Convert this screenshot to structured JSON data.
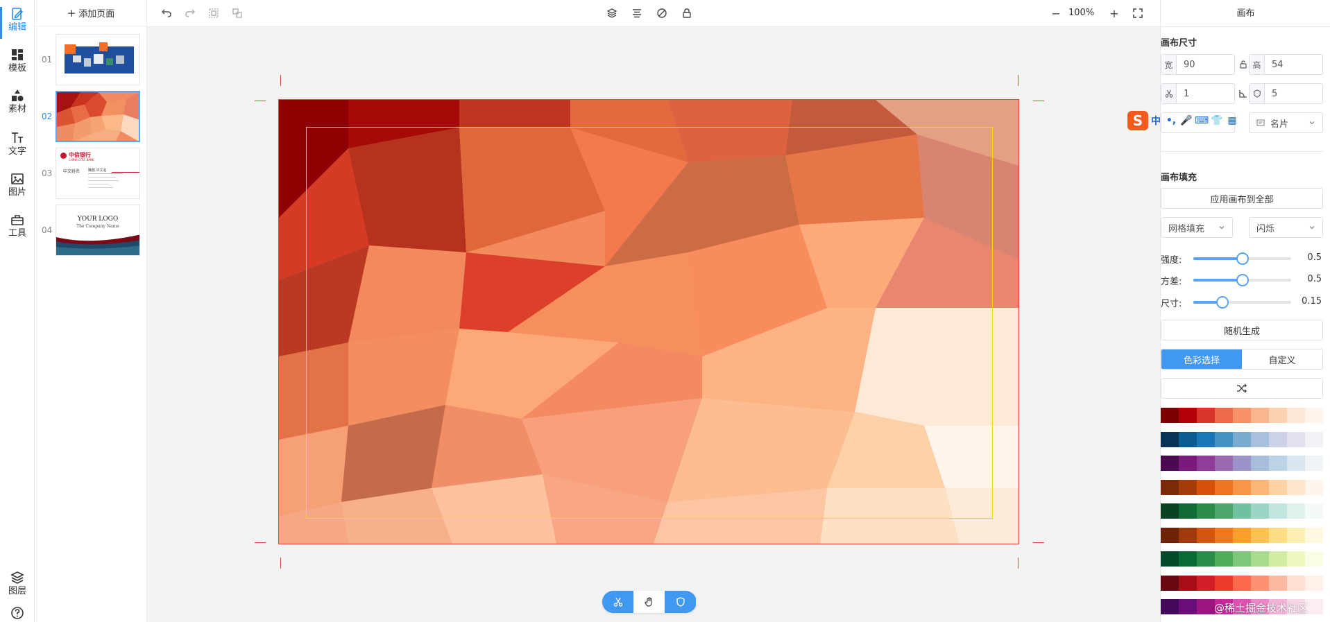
{
  "sidebar": {
    "items": [
      {
        "label": "编辑",
        "icon": "edit-icon"
      },
      {
        "label": "模板",
        "icon": "template-icon"
      },
      {
        "label": "素材",
        "icon": "shapes-icon"
      },
      {
        "label": "文字",
        "icon": "text-icon"
      },
      {
        "label": "图片",
        "icon": "image-icon"
      },
      {
        "label": "工具",
        "icon": "toolbox-icon"
      }
    ],
    "bottom_items": [
      {
        "label": "图层",
        "icon": "layers-icon"
      },
      {
        "label": "",
        "icon": "help-icon"
      }
    ]
  },
  "pages": {
    "add_label": "添加页面",
    "items": [
      {
        "num": "01"
      },
      {
        "num": "02"
      },
      {
        "num": "03",
        "bank_name": "中信银行",
        "bank_sub": "CHINA CITIC BANK",
        "person": "中文姓名",
        "role": "職務 中文名"
      },
      {
        "num": "04",
        "logo": "YOUR LOGO",
        "company": "The Company Name"
      }
    ]
  },
  "toolbar": {
    "zoom": "100%",
    "zoom_out": "−",
    "zoom_in": "+"
  },
  "panel": {
    "title": "画布",
    "size_section": "画布尺寸",
    "width_label": "宽",
    "width_value": "90",
    "height_label": "高",
    "height_value": "54",
    "bleed_value": "1",
    "radius_value": "5",
    "preset_value": "名片",
    "fill_section": "画布填充",
    "apply_all": "应用画布到全部",
    "fill_type": "网格填充",
    "fill_style": "闪烁",
    "sliders": [
      {
        "label": "强度:",
        "value": "0.5",
        "ratio": 0.5
      },
      {
        "label": "方差:",
        "value": "0.5",
        "ratio": 0.5
      },
      {
        "label": "尺寸:",
        "value": "0.15",
        "ratio": 0.3
      }
    ],
    "random": "随机生成",
    "tab_color": "色彩选择",
    "tab_custom": "自定义",
    "palettes": [
      [
        "#7a0003",
        "#b30006",
        "#d9352a",
        "#ee6a4b",
        "#f69168",
        "#f8b58e",
        "#fbd2b0",
        "#fde7d6",
        "#fff5ec"
      ],
      [
        "#083357",
        "#0b5c91",
        "#1a76b7",
        "#4792c5",
        "#79abd1",
        "#a7c0de",
        "#cdd1e8",
        "#e3e0ee",
        "#f3f1f6"
      ],
      [
        "#4b0a4f",
        "#7a1a7d",
        "#8f3c9a",
        "#9c6aae",
        "#9a94c8",
        "#a8bcdd",
        "#bcd3e6",
        "#d9e6ef",
        "#eef4f7"
      ],
      [
        "#7a2c0a",
        "#a53d0b",
        "#d8510b",
        "#ee7323",
        "#f79648",
        "#fbb576",
        "#fdd1a4",
        "#fee6cc",
        "#fff5ea"
      ],
      [
        "#0a4321",
        "#0f6b33",
        "#2b8b4b",
        "#4ca76a",
        "#6fc1a0",
        "#9bd5c5",
        "#c2e6df",
        "#e0f2ee",
        "#f3faf8"
      ],
      [
        "#6e2308",
        "#a0390b",
        "#d4560d",
        "#ef7a1f",
        "#fb9f2c",
        "#fdc151",
        "#fddd83",
        "#fdefb4",
        "#fff9e1"
      ],
      [
        "#044a2a",
        "#0a6a36",
        "#2a8c49",
        "#4fac5b",
        "#7ec779",
        "#a9db8e",
        "#d0eca2",
        "#ecf7c2",
        "#f9fde5"
      ],
      [
        "#6a0814",
        "#a50f15",
        "#d21f26",
        "#ef3b2c",
        "#fb6a4a",
        "#fc9272",
        "#fcbba1",
        "#fee0d2",
        "#fff1ea"
      ],
      [
        "#44085a",
        "#6a0d78",
        "#9b1480",
        "#c9269c",
        "#e052b2",
        "#ec86c6",
        "#f3b3d8",
        "#f8d7e9",
        "#fcedf4"
      ]
    ]
  },
  "canvas": {
    "colors": {
      "accent": "#2d8cf0",
      "crop_marks": "#e0463a",
      "safe_line": "#ffd700"
    }
  },
  "ime": {
    "logo": "S",
    "lang": "中",
    "punct": "•,",
    "mic": "🎤",
    "kbd": "⌨",
    "skin": "👕",
    "apps": "▦"
  },
  "watermark": "@稀土掘金技术社区"
}
